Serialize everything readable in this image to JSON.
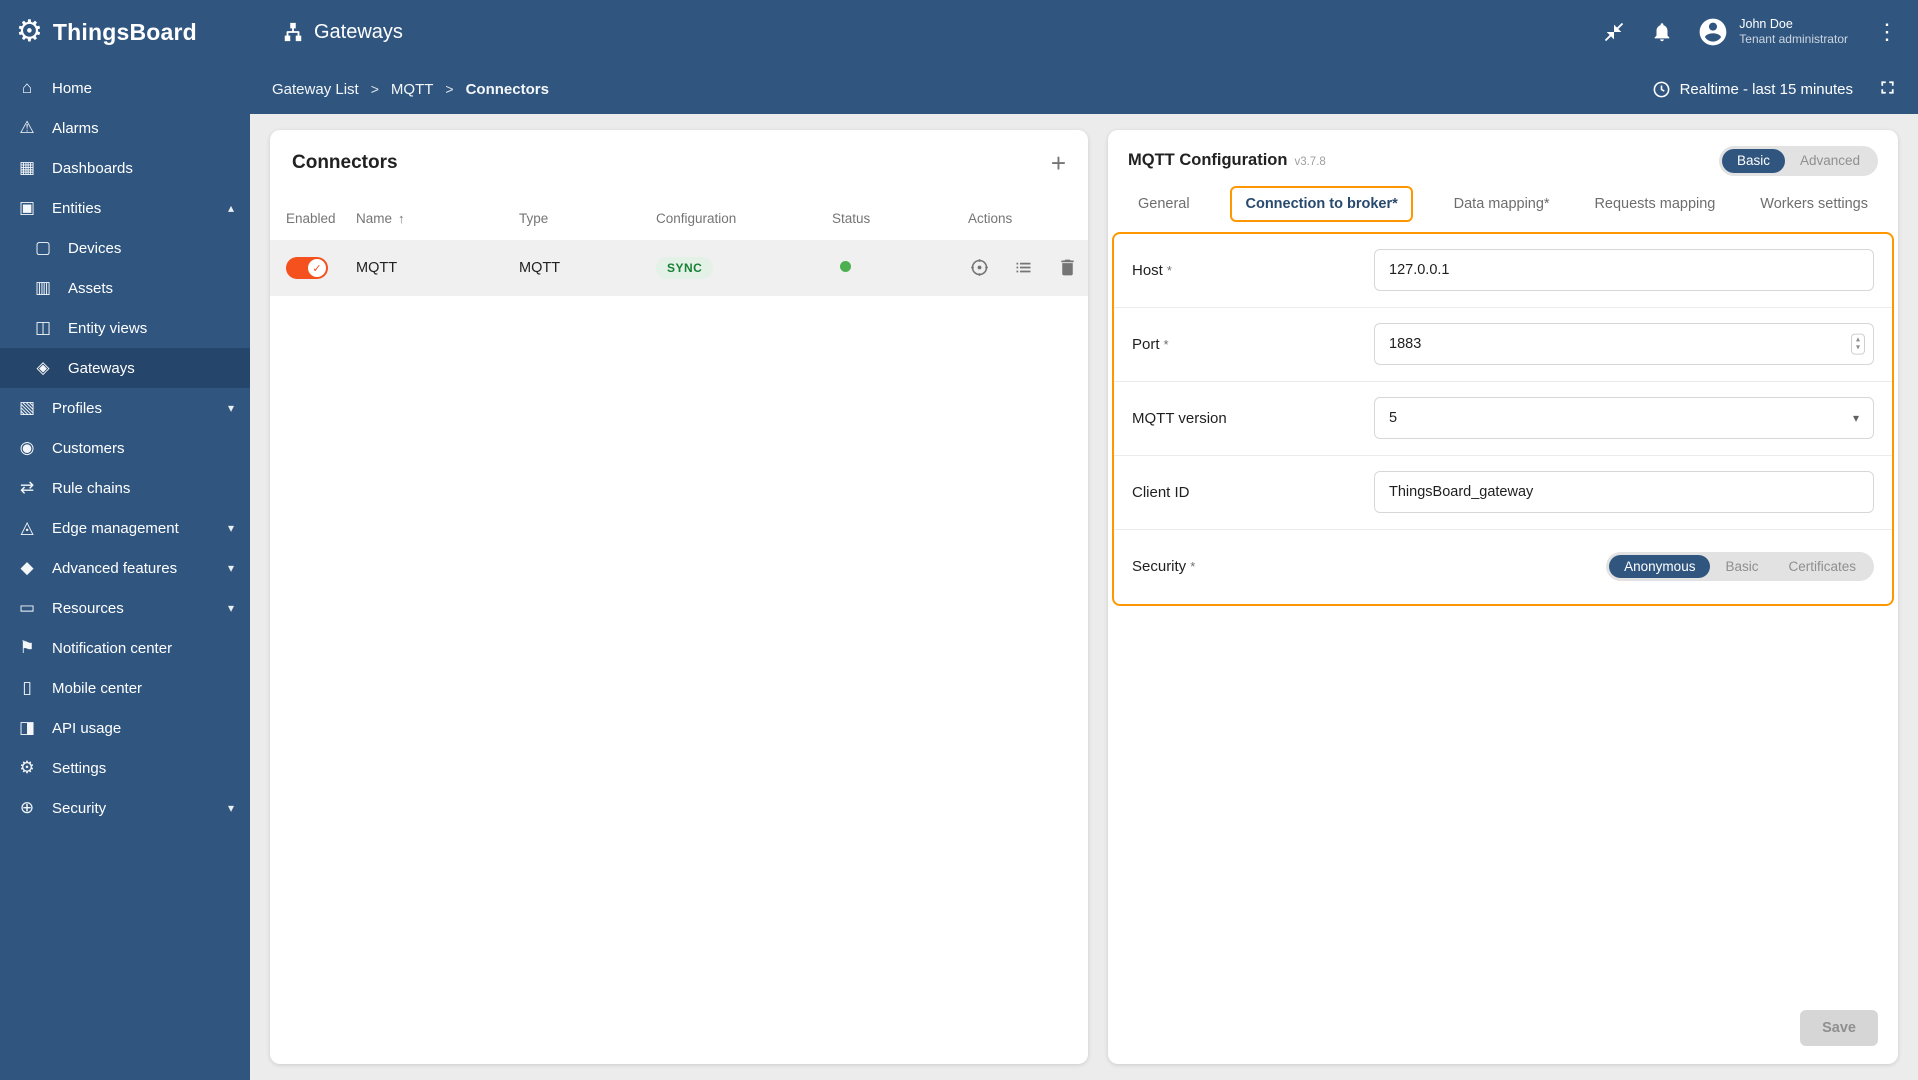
{
  "app": {
    "name": "ThingsBoard",
    "page_title": "Gateways"
  },
  "topbar": {
    "user_name": "John Doe",
    "user_role": "Tenant administrator"
  },
  "breadcrumb": {
    "items": [
      "Gateway List",
      "MQTT",
      "Connectors"
    ],
    "separator": ">",
    "realtime_label": "Realtime - last 15 minutes"
  },
  "sidebar": {
    "items": [
      {
        "label": "Home",
        "icon": "⌂"
      },
      {
        "label": "Alarms",
        "icon": "⚠"
      },
      {
        "label": "Dashboards",
        "icon": "▦"
      },
      {
        "label": "Entities",
        "icon": "▣"
      },
      {
        "label": "Devices",
        "icon": "▢"
      },
      {
        "label": "Assets",
        "icon": "▥"
      },
      {
        "label": "Entity views",
        "icon": "◫"
      },
      {
        "label": "Gateways",
        "icon": "◈"
      },
      {
        "label": "Profiles",
        "icon": "▧"
      },
      {
        "label": "Customers",
        "icon": "◉"
      },
      {
        "label": "Rule chains",
        "icon": "⇄"
      },
      {
        "label": "Edge management",
        "icon": "◬"
      },
      {
        "label": "Advanced features",
        "icon": "◆"
      },
      {
        "label": "Resources",
        "icon": "▭"
      },
      {
        "label": "Notification center",
        "icon": "⚑"
      },
      {
        "label": "Mobile center",
        "icon": "▯"
      },
      {
        "label": "API usage",
        "icon": "◨"
      },
      {
        "label": "Settings",
        "icon": "⚙"
      },
      {
        "label": "Security",
        "icon": "⊕"
      }
    ]
  },
  "icons": {
    "logo": "⚙",
    "chevron_up": "▴",
    "chevron_down": "▾",
    "sort_asc": "↑",
    "kebab": "⋮",
    "plus": "+",
    "dropdown": "▾",
    "spin_up": "▴",
    "spin_down": "▾",
    "check": "✓"
  },
  "connectors_card": {
    "title": "Connectors",
    "columns": [
      "Enabled",
      "Name",
      "Type",
      "Configuration",
      "Status",
      "Actions"
    ],
    "row": {
      "name": "MQTT",
      "type": "MQTT",
      "configuration": "SYNC"
    }
  },
  "config_card": {
    "title": "MQTT Configuration",
    "version": "v3.7.8",
    "modes": [
      "Basic",
      "Advanced"
    ],
    "tabs": [
      "General",
      "Connection to broker*",
      "Data mapping*",
      "Requests mapping",
      "Workers settings"
    ],
    "fields": {
      "host": {
        "label": "Host",
        "req": "*",
        "value": "127.0.0.1"
      },
      "port": {
        "label": "Port",
        "req": "*",
        "value": "1883"
      },
      "mqtt_version": {
        "label": "MQTT version",
        "req": "",
        "value": "5"
      },
      "client_id": {
        "label": "Client ID",
        "req": "",
        "value": "ThingsBoard_gateway"
      },
      "security": {
        "label": "Security",
        "req": "*",
        "options": [
          "Anonymous",
          "Basic",
          "Certificates"
        ],
        "selected": "Anonymous"
      }
    },
    "save_label": "Save"
  },
  "colors": {
    "primary": "#305680",
    "sidebar_active": "#26456a",
    "highlight_orange": "#ff9800",
    "toggle_on": "#f4511e",
    "status_green": "#4caf50",
    "sync_chip_text": "#198038"
  }
}
